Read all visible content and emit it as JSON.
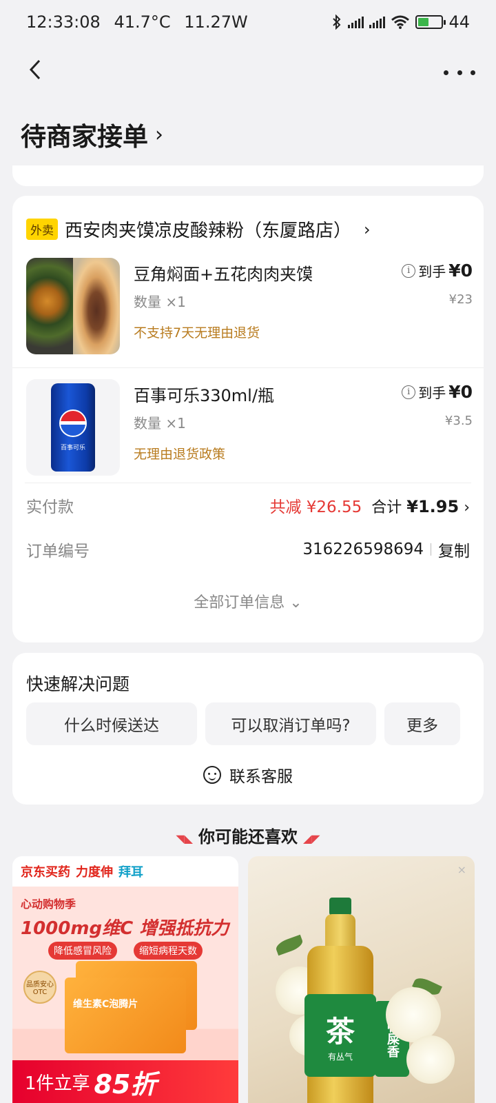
{
  "status_bar": {
    "time": "12:33:08",
    "temperature": "41.7°C",
    "power": "11.27W",
    "battery": "44"
  },
  "nav": {
    "back_icon": "chevron-left-icon",
    "more_icon": "more-dots-icon"
  },
  "page_title": "待商家接单",
  "order": {
    "store_tag": "外卖",
    "store_name": "西安肉夹馍凉皮酸辣粉（东厦路店）",
    "items": [
      {
        "name": "豆角焖面+五花肉肉夹馍",
        "qty": "数量 ×1",
        "policy": "不支持7天无理由退货",
        "receive_label": "到手",
        "receive_price": "¥0",
        "orig_price": "¥23"
      },
      {
        "name": "百事可乐330ml/瓶",
        "qty": "数量 ×1",
        "policy": "无理由退货政策",
        "receive_label": "到手",
        "receive_price": "¥0",
        "orig_price": "¥3.5"
      }
    ],
    "paid_label": "实付款",
    "discount": "共减 ¥26.55",
    "total_label": "合计",
    "total_value": "¥1.95",
    "order_no_label": "订单编号",
    "order_no": "316226598694",
    "copy_label": "复制",
    "all_info": "全部订单信息"
  },
  "quick": {
    "title": "快速解决问题",
    "buttons": [
      "什么时候送达",
      "可以取消订单吗?",
      "更多"
    ],
    "contact": "联系客服"
  },
  "recommend": {
    "title": "你可能还喜欢",
    "ad1": {
      "brand_jd": "京东买药",
      "brand_lkb": "力度伸",
      "brand_bayer": "拜耳",
      "line1": "心动购物季",
      "line2": "1000mg维C 增强抵抗力",
      "pill1": "降低感冒风险",
      "pill2": "缩短病程天数",
      "seal": "品质安心 OTC",
      "box_text": "维生素C泡腾片",
      "bottom_a": "1件立享",
      "bottom_b": "85折"
    },
    "ad2": {
      "close": "×",
      "label_big": "茶",
      "label_small": "有丛气",
      "side_label": "鸭屎香"
    }
  },
  "colors": {
    "accent_red": "#e53935",
    "policy_orange": "#b87b1e",
    "tag_yellow": "#ffd400"
  }
}
